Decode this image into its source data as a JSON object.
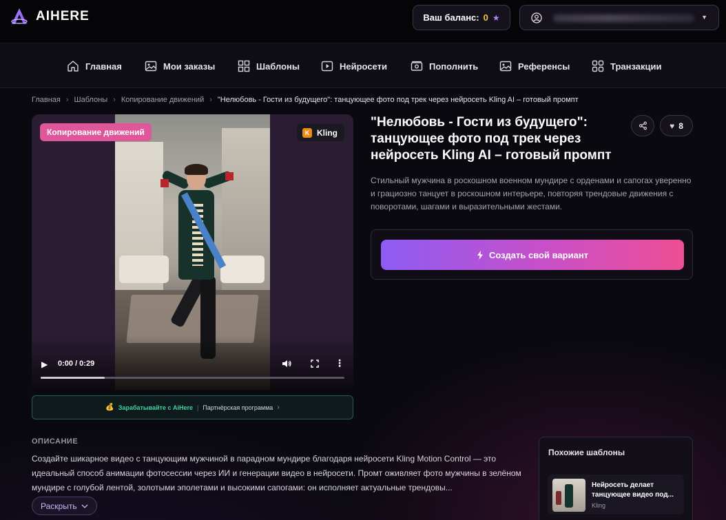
{
  "brand": {
    "name": "AIHERE"
  },
  "balance": {
    "label": "Ваш баланс:",
    "value": "0"
  },
  "nav": {
    "items": [
      {
        "label": "Главная",
        "icon": "home-icon"
      },
      {
        "label": "Мои заказы",
        "icon": "image-icon"
      },
      {
        "label": "Шаблоны",
        "icon": "grid-icon"
      },
      {
        "label": "Нейросети",
        "icon": "play-icon"
      },
      {
        "label": "Пополнить",
        "icon": "wallet-icon"
      },
      {
        "label": "Референсы",
        "icon": "image-icon"
      },
      {
        "label": "Транзакции",
        "icon": "grid-icon"
      }
    ]
  },
  "breadcrumb": {
    "items": [
      "Главная",
      "Шаблоны",
      "Копирование движений"
    ],
    "current": "\"Нелюбовь - Гости из будущего\": танцующее фото под трек через нейросеть Kling AI – готовый промпт"
  },
  "video": {
    "category_badge": "Копирование движений",
    "model_badge": "Kling",
    "model_letter": "K",
    "time": "0:00 / 0:29",
    "progress_fraction": 0.21
  },
  "partner": {
    "earn_text": "Зарабатывайте с AiHere",
    "program_text": "Партнёрская программа"
  },
  "template": {
    "title": "\"Нелюбовь - Гости из будущего\": танцующее фото под трек через нейросеть Kling AI – готовый промпт",
    "likes": "8",
    "short_description": "Стильный мужчина в роскошном военном мундире с орденами и сапогах уверенно и грациозно танцует в роскошном интерьере, повторяя трендовые движения с поворотами, шагами и выразительными жестами.",
    "create_button": "Создать свой вариант"
  },
  "description": {
    "heading": "ОПИСАНИЕ",
    "body": "Создайте шикарное видео с танцующим мужчиной в парадном мундире благодаря нейросети Kling Motion Control — это идеальный способ анимации фотосессии через ИИ и генерации видео в нейросети. Промт оживляет фото мужчины в зелёном мундире с голубой лентой, золотыми эполетами и высокими сапогами: он исполняет актуальные трендовы...",
    "expand_label": "Раскрыть"
  },
  "similar": {
    "heading": "Похожие шаблоны",
    "items": [
      {
        "name": "Нейросеть делает танцующее видео под...",
        "tag": "Kling"
      }
    ]
  },
  "colors": {
    "accent_start": "#8d5cf5",
    "accent_end": "#ee4f95",
    "badge_pink": "#e0569a",
    "balance_value": "#f3c33c",
    "partner_green": "#3fd3a0"
  }
}
